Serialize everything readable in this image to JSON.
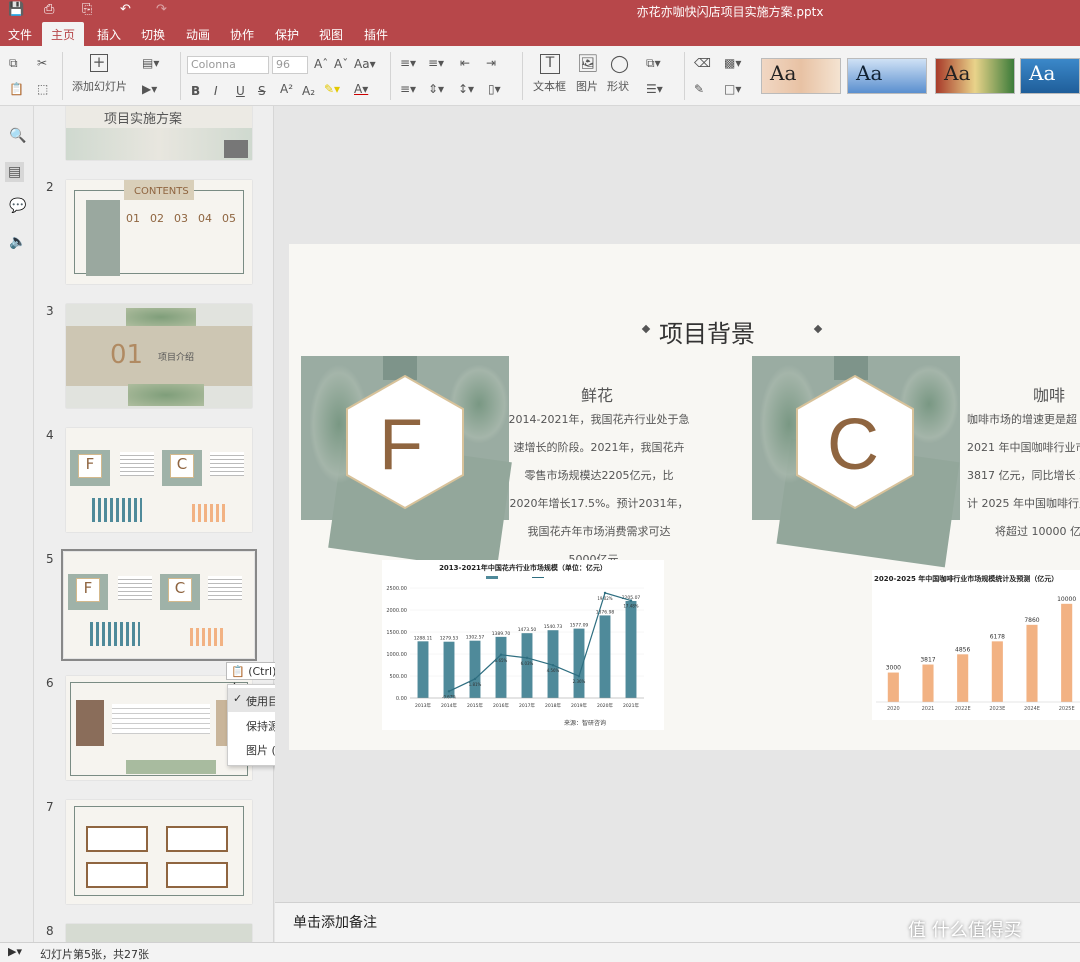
{
  "window": {
    "title": "亦花亦咖快闪店项目实施方案.pptx"
  },
  "menu": [
    "文件",
    "主页",
    "插入",
    "切换",
    "动画",
    "协作",
    "保护",
    "视图",
    "插件"
  ],
  "menu_active": "主页",
  "ribbon": {
    "add_slide": "添加幻灯片",
    "font_name": "Colonna",
    "font_size": "96",
    "textbox": "文本框",
    "picture": "图片",
    "shape": "形状",
    "theme_sample": "Aa"
  },
  "thumbnails": {
    "numbers": [
      "2",
      "3",
      "4",
      "5",
      "6",
      "7",
      "8"
    ],
    "slide1_title": "项目实施方案",
    "slide2_heading": "CONTENTS",
    "slide2_nums": [
      "01",
      "02",
      "03",
      "04",
      "05"
    ],
    "slide3_num": "01",
    "slide3_text": "项目介绍",
    "slide_f": "F",
    "slide_c": "C"
  },
  "paste_button": "(Ctrl)",
  "paste_menu": [
    "使用目标主题 (H)",
    "保持源格式 (K)",
    "图片 (U)"
  ],
  "slide": {
    "title": "项目背景",
    "flower": {
      "letter": "F",
      "heading": "鲜花",
      "lines": [
        "2014-2021年，我国花卉行业处于急",
        "速增长的阶段。2021年，我国花卉",
        "零售市场规模达2205亿元，比",
        "2020年增长17.5%。预计2031年，",
        "我国花卉年市场消费需求可达",
        "5000亿元。"
      ]
    },
    "coffee": {
      "letter": "C",
      "heading": "咖啡",
      "lines": [
        "咖啡市场的增速更是超",
        "2021 年中国咖啡行业市",
        "3817 亿元，同比增长 2",
        "计 2025 年中国咖啡行业",
        "将超过 10000 亿"
      ]
    }
  },
  "chart_data": [
    {
      "type": "bar",
      "title": "2013-2021年中国花卉行业市场规模（单位：亿元）",
      "categories": [
        "2013年",
        "2014年",
        "2015年",
        "2016年",
        "2017年",
        "2018年",
        "2019年",
        "2020年",
        "2021年"
      ],
      "series": [
        {
          "values": [
            1288.11,
            1279.53,
            1302.57,
            1389.7,
            1473.5,
            1540.73,
            1577.09,
            1876.98,
            2205.07
          ]
        }
      ],
      "ylim": [
        0,
        2500
      ],
      "yticks": [
        "0.00",
        "500.00",
        "1000.00",
        "1500.00",
        "2000.00",
        "2500.00"
      ],
      "secondary_line_labels": [
        "",
        "-0.67%",
        "1.81%",
        "6.65%",
        "6.03%",
        "4.56%",
        "2.36%",
        "19.02%",
        "17.48%"
      ],
      "secondary_line_values": [
        null,
        -0.67,
        1.81,
        6.65,
        6.03,
        4.56,
        2.36,
        19.02,
        17.48
      ],
      "secondary_ylim": [
        -2,
        20
      ],
      "source": "来源：智研咨询",
      "colors": {
        "bar": "#4f8a9a",
        "line": "#2e6e80"
      }
    },
    {
      "type": "bar",
      "title": "2020-2025 年中国咖啡行业市场规模统计及预测（亿元）",
      "categories": [
        "2020",
        "2021",
        "2022E",
        "2023E",
        "2024E",
        "2025E"
      ],
      "values": [
        3000,
        3817,
        4856,
        6178,
        7860,
        10000
      ],
      "data_labels": [
        "3000",
        "3817",
        "4856",
        "6178",
        "7860",
        "10000"
      ],
      "ylim": [
        0,
        11000
      ],
      "colors": {
        "bar": "#f2b283"
      }
    }
  ],
  "notes": {
    "placeholder": "单击添加备注"
  },
  "status": {
    "text": "幻灯片第5张，共27张"
  },
  "watermark": "值 什么值得买",
  "colors": {
    "accent": "#b7474a",
    "brown": "#8f6540",
    "sage": "#9fb2a8"
  }
}
